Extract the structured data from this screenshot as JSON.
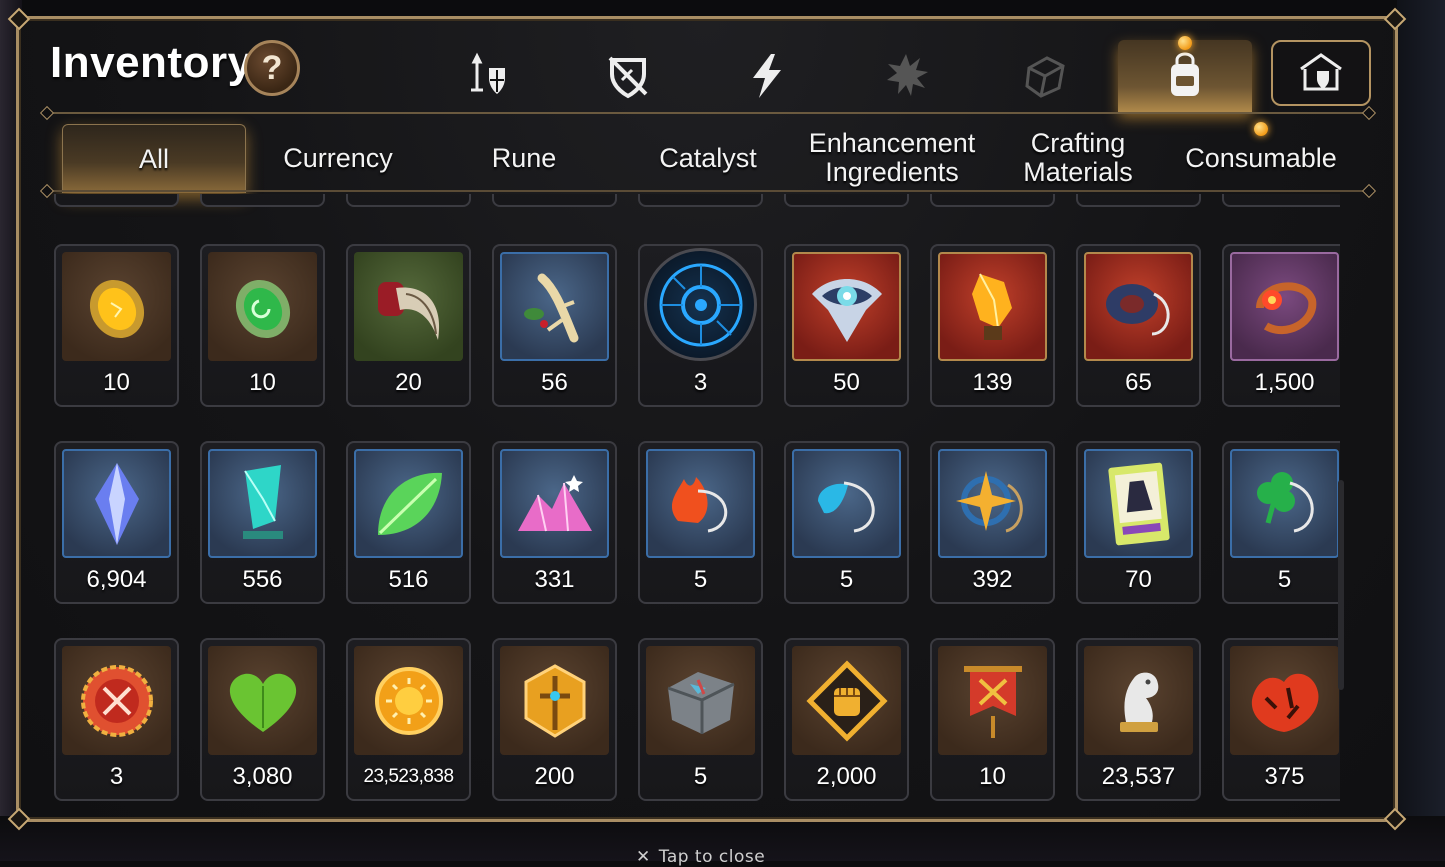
{
  "window": {
    "title": "Inventory",
    "help_label": "?"
  },
  "category_tabs": [
    {
      "icon": "champion-gear-icon",
      "active": false
    },
    {
      "icon": "no-shield-icon",
      "active": false
    },
    {
      "icon": "lightning-icon",
      "active": false
    },
    {
      "icon": "splat-icon",
      "active": false
    },
    {
      "icon": "cube-icon",
      "active": false
    },
    {
      "icon": "backpack-icon",
      "active": true,
      "notification": true
    },
    {
      "icon": "guild-house-icon",
      "active": false
    }
  ],
  "sub_tabs": [
    {
      "label": "All",
      "active": true
    },
    {
      "label": "Currency",
      "active": false
    },
    {
      "label": "Rune",
      "active": false
    },
    {
      "label": "Catalyst",
      "active": false
    },
    {
      "label": "Enhancement\nIngredients",
      "active": false
    },
    {
      "label": "Crafting\nMaterials",
      "active": false
    },
    {
      "label": "Consumable",
      "active": false,
      "notification": true
    }
  ],
  "items": [
    {
      "count": "10",
      "icon": "amber-gem-icon"
    },
    {
      "count": "10",
      "icon": "emerald-gem-icon"
    },
    {
      "count": "20",
      "icon": "claw-icon"
    },
    {
      "count": "56",
      "icon": "root-herb-icon"
    },
    {
      "count": "3",
      "icon": "blue-rune-disc-icon"
    },
    {
      "count": "50",
      "icon": "eye-amulet-icon"
    },
    {
      "count": "139",
      "icon": "fire-crystal-icon"
    },
    {
      "count": "65",
      "icon": "dark-ring-pendant-icon"
    },
    {
      "count": "1,500",
      "icon": "flower-ring-icon"
    },
    {
      "count": "6,904",
      "icon": "blue-crystal-icon"
    },
    {
      "count": "556",
      "icon": "teal-crystal-icon"
    },
    {
      "count": "516",
      "icon": "leaf-icon"
    },
    {
      "count": "331",
      "icon": "pink-crystal-pile-icon"
    },
    {
      "count": "5",
      "icon": "fire-charm-icon"
    },
    {
      "count": "5",
      "icon": "water-charm-icon"
    },
    {
      "count": "392",
      "icon": "star-charm-icon"
    },
    {
      "count": "70",
      "icon": "costume-card-icon"
    },
    {
      "count": "5",
      "icon": "clover-charm-icon"
    },
    {
      "count": "3",
      "icon": "red-badge-icon"
    },
    {
      "count": "3,080",
      "icon": "green-heart-icon"
    },
    {
      "count": "23,523,838",
      "icon": "gold-coin-icon"
    },
    {
      "count": "200",
      "icon": "sword-emblem-icon"
    },
    {
      "count": "5",
      "icon": "stone-block-icon"
    },
    {
      "count": "2,000",
      "icon": "fist-emblem-icon"
    },
    {
      "count": "10",
      "icon": "war-banner-icon"
    },
    {
      "count": "23,537",
      "icon": "knight-chess-icon"
    },
    {
      "count": "375",
      "icon": "autumn-leaf-icon"
    }
  ],
  "footer": {
    "close_hint": "Tap to close"
  },
  "colors": {
    "accent": "#a98e64",
    "notification": "#f29b18"
  }
}
